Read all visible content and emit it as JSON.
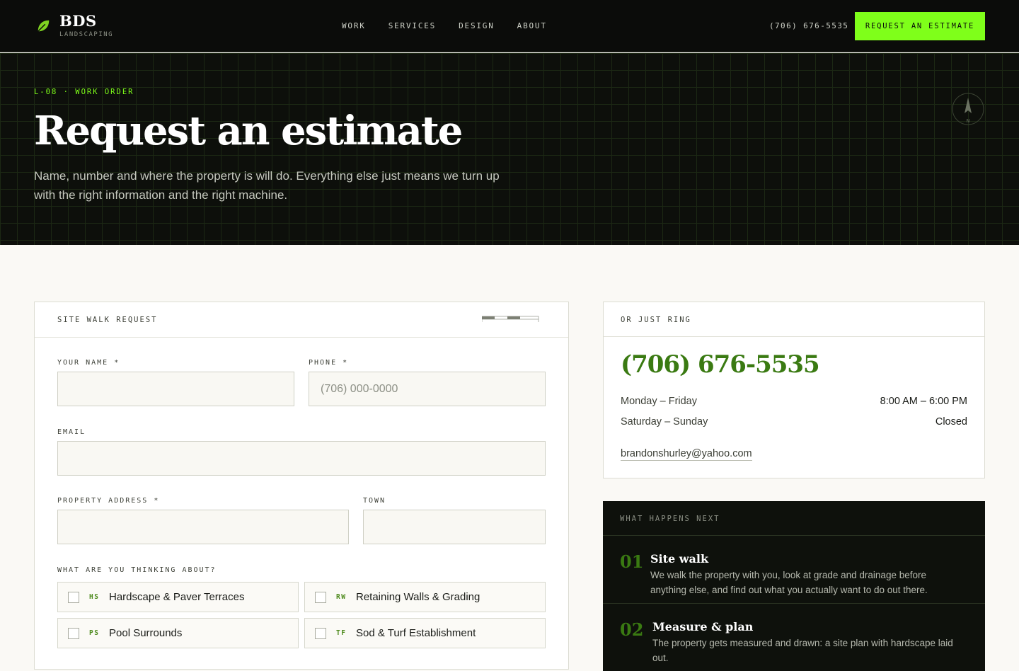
{
  "brand": {
    "name": "BDS",
    "sub": "LANDSCAPING"
  },
  "nav": {
    "links": [
      "WORK",
      "SERVICES",
      "DESIGN",
      "ABOUT"
    ],
    "phone": "(706) 676-5535",
    "cta": "REQUEST AN ESTIMATE"
  },
  "hero": {
    "eyebrow": "L-08 · WORK ORDER",
    "title": "Request an estimate",
    "subtitle": "Name, number and where the property is will do. Everything else just means we turn up with the right information and the right machine.",
    "compass_label": "N"
  },
  "form": {
    "title": "SITE WALK REQUEST",
    "fields": {
      "name_label": "YOUR NAME *",
      "phone_label": "PHONE *",
      "phone_placeholder": "(706) 000-0000",
      "email_label": "EMAIL",
      "address_label": "PROPERTY ADDRESS *",
      "town_label": "TOWN"
    },
    "interests_label": "WHAT ARE YOU THINKING ABOUT?",
    "interests": [
      {
        "code": "HS",
        "label": "Hardscape & Paver Terraces"
      },
      {
        "code": "RW",
        "label": "Retaining Walls & Grading"
      },
      {
        "code": "PS",
        "label": "Pool Surrounds"
      },
      {
        "code": "TF",
        "label": "Sod & Turf Establishment"
      }
    ]
  },
  "ring": {
    "title": "OR JUST RING",
    "phone": "(706) 676-5535",
    "hours": [
      {
        "days": "Monday – Friday",
        "time": "8:00 AM – 6:00 PM"
      },
      {
        "days": "Saturday – Sunday",
        "time": "Closed"
      }
    ],
    "email": "brandonshurley@yahoo.com"
  },
  "next": {
    "title": "WHAT HAPPENS NEXT",
    "steps": [
      {
        "num": "01",
        "title": "Site walk",
        "desc": "We walk the property with you, look at grade and drainage before anything else, and find out what you actually want to do out there."
      },
      {
        "num": "02",
        "title": "Measure & plan",
        "desc": "The property gets measured and drawn: a site plan with hardscape laid out."
      }
    ]
  },
  "colors": {
    "accent": "#7fff1a",
    "green": "#3a7a12",
    "dark": "#0b0c0a"
  }
}
